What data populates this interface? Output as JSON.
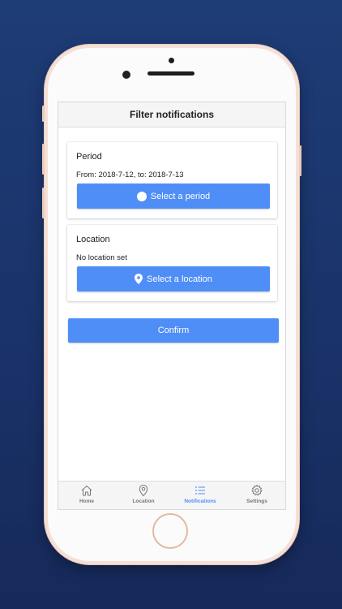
{
  "header": {
    "title": "Filter notifications"
  },
  "period": {
    "title": "Period",
    "text": "From: 2018-7-12, to: 2018-7-13",
    "button_label": "Select a period"
  },
  "location": {
    "title": "Location",
    "text": "No location set",
    "button_label": "Select a location"
  },
  "confirm": {
    "label": "Confirm"
  },
  "tabs": [
    {
      "label": "Home",
      "icon": "home-icon",
      "active": false
    },
    {
      "label": "Location",
      "icon": "location-pin-icon",
      "active": false
    },
    {
      "label": "Notifications",
      "icon": "list-icon",
      "active": true
    },
    {
      "label": "Settings",
      "icon": "gear-icon",
      "active": false
    }
  ],
  "colors": {
    "accent": "#4f8ef7",
    "background": "#1e3c76",
    "phone_frame": "#f4e0d6"
  }
}
